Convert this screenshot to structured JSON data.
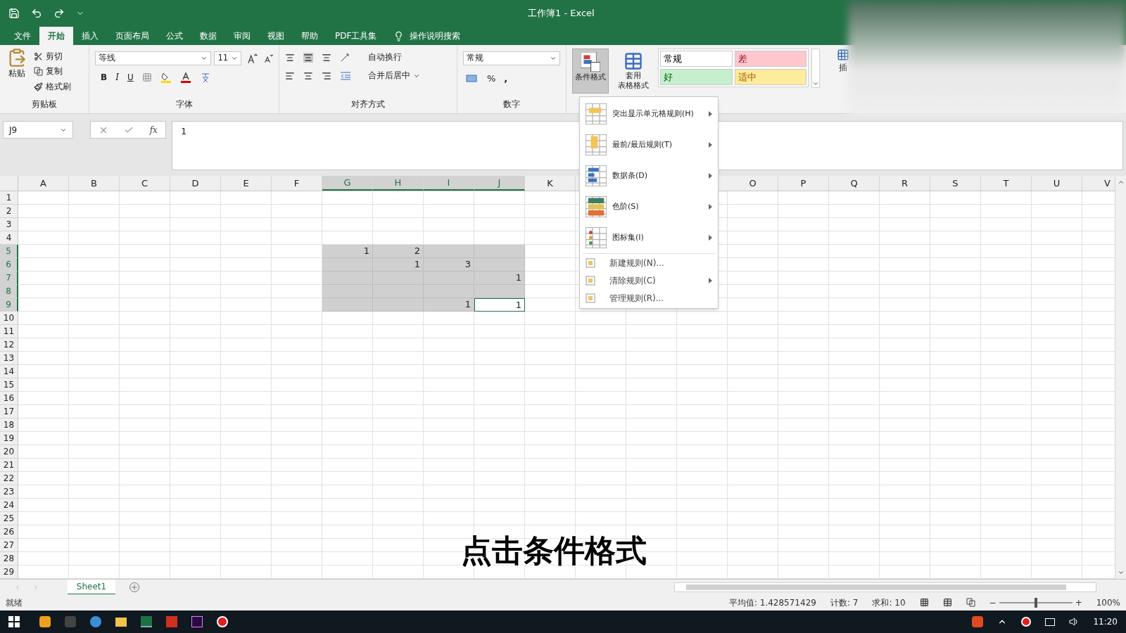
{
  "title_bar": {
    "title": "工作簿1 - Excel"
  },
  "ribbon_tabs": [
    {
      "label": "文件",
      "selected": false
    },
    {
      "label": "开始",
      "selected": true
    },
    {
      "label": "插入",
      "selected": false
    },
    {
      "label": "页面布局",
      "selected": false
    },
    {
      "label": "公式",
      "selected": false
    },
    {
      "label": "数据",
      "selected": false
    },
    {
      "label": "审阅",
      "selected": false
    },
    {
      "label": "视图",
      "selected": false
    },
    {
      "label": "帮助",
      "selected": false
    },
    {
      "label": "PDF工具集",
      "selected": false
    }
  ],
  "tell_me": {
    "label": "操作说明搜索"
  },
  "ribbon": {
    "clipboard": {
      "paste": "粘贴",
      "cut": "剪切",
      "copy": "复制",
      "format_painter": "格式刷",
      "group": "剪贴板"
    },
    "font": {
      "name": "等线",
      "size": "11",
      "bold": "B",
      "italic": "I",
      "underline": "U",
      "group": "字体"
    },
    "alignment": {
      "wrap": "自动换行",
      "merge": "合并后居中",
      "group": "对齐方式"
    },
    "number": {
      "format": "常规",
      "percent": "%",
      "comma": ",",
      "group": "数字"
    },
    "conditional_formatting": {
      "label": "条件格式",
      "pressed": true
    },
    "format_as_table": {
      "label_1": "套用",
      "label_2": "表格格式"
    },
    "cell_styles": [
      {
        "label": "常规",
        "color": "#ffffff"
      },
      {
        "label": "差",
        "color": "#ffc7ce"
      },
      {
        "label": "好",
        "color": "#c6efce"
      },
      {
        "label": "适中",
        "color": "#ffeb9c"
      }
    ],
    "insert": {
      "label": "插"
    }
  },
  "formula_bar": {
    "name_box": "J9",
    "fx": "fx",
    "value": "1"
  },
  "sheet": {
    "columns": [
      {
        "label": "A",
        "selected": false
      },
      {
        "label": "B",
        "selected": false
      },
      {
        "label": "C",
        "selected": false
      },
      {
        "label": "D",
        "selected": false
      },
      {
        "label": "E",
        "selected": false
      },
      {
        "label": "F",
        "selected": false
      },
      {
        "label": "G",
        "selected": true
      },
      {
        "label": "H",
        "selected": true
      },
      {
        "label": "I",
        "selected": true
      },
      {
        "label": "J",
        "selected": true
      },
      {
        "label": "K",
        "selected": false
      },
      {
        "kind": "covered"
      },
      {
        "kind": "covered"
      },
      {
        "kind": "covered"
      },
      {
        "label": "O",
        "selected": false
      },
      {
        "label": "P",
        "selected": false
      },
      {
        "label": "Q",
        "selected": false
      },
      {
        "label": "R",
        "selected": false
      },
      {
        "label": "S",
        "selected": false
      },
      {
        "label": "T",
        "selected": false
      },
      {
        "label": "U",
        "selected": false
      },
      {
        "label": "V",
        "selected": false
      }
    ],
    "rows": [
      {
        "label": "1",
        "selected": false
      },
      {
        "label": "2",
        "selected": false
      },
      {
        "label": "3",
        "selected": false
      },
      {
        "label": "4",
        "selected": false
      },
      {
        "label": "5",
        "selected": true,
        "cells": [
          {
            "kind": "value",
            "value": "1"
          },
          {
            "kind": "value",
            "value": "2"
          },
          {
            "kind": "blank"
          },
          {
            "kind": "blank"
          }
        ]
      },
      {
        "label": "6",
        "selected": true,
        "cells": [
          {
            "kind": "blank"
          },
          {
            "kind": "value",
            "value": "1"
          },
          {
            "kind": "value",
            "value": "3"
          },
          {
            "kind": "blank"
          }
        ]
      },
      {
        "label": "7",
        "selected": true,
        "cells": [
          {
            "kind": "blank"
          },
          {
            "kind": "blank"
          },
          {
            "kind": "blank"
          },
          {
            "kind": "value",
            "value": "1"
          }
        ]
      },
      {
        "label": "8",
        "selected": true,
        "cells": [
          {
            "kind": "blank"
          },
          {
            "kind": "blank"
          },
          {
            "kind": "blank"
          },
          {
            "kind": "blank"
          }
        ]
      },
      {
        "label": "9",
        "selected": true,
        "cells": [
          {
            "kind": "blank"
          },
          {
            "kind": "blank"
          },
          {
            "kind": "value",
            "value": "1"
          },
          {
            "kind": "active",
            "value": "1"
          }
        ]
      },
      {
        "label": "10",
        "selected": false
      },
      {
        "label": "11",
        "selected": false
      },
      {
        "label": "12",
        "selected": false
      },
      {
        "label": "13",
        "selected": false
      },
      {
        "label": "14",
        "selected": false
      },
      {
        "label": "15",
        "selected": false
      },
      {
        "label": "16",
        "selected": false
      },
      {
        "label": "17",
        "selected": false
      },
      {
        "label": "18",
        "selected": false
      },
      {
        "label": "19",
        "selected": false
      },
      {
        "label": "20",
        "selected": false
      },
      {
        "label": "21",
        "selected": false
      },
      {
        "label": "22",
        "selected": false
      },
      {
        "label": "23",
        "selected": false
      },
      {
        "label": "24",
        "selected": false
      },
      {
        "label": "25",
        "selected": false
      },
      {
        "label": "26",
        "selected": false
      },
      {
        "label": "27",
        "selected": false
      },
      {
        "label": "28",
        "selected": false
      },
      {
        "label": "29",
        "selected": false
      }
    ]
  },
  "cf_menu": {
    "items": [
      {
        "kind": "large",
        "label": "突出显示单元格规则(H)",
        "submenu": true
      },
      {
        "kind": "large",
        "label": "最前/最后规则(T)",
        "submenu": true
      },
      {
        "kind": "large",
        "label": "数据条(D)",
        "submenu": true
      },
      {
        "kind": "large",
        "label": "色阶(S)",
        "submenu": true
      },
      {
        "kind": "large",
        "label": "图标集(I)",
        "submenu": true
      },
      {
        "kind": "small",
        "label": "新建规则(N)...",
        "submenu": false
      },
      {
        "kind": "small",
        "label": "清除规则(C)",
        "submenu": true
      },
      {
        "kind": "small",
        "label": "管理规则(R)...",
        "submenu": false
      }
    ]
  },
  "sheet_tabs": [
    {
      "label": "Sheet1",
      "selected": true
    }
  ],
  "status_bar": {
    "ready": "就绪",
    "average": "平均值: 1.428571429",
    "count": "计数: 7",
    "sum": "求和: 10",
    "zoom_out": "−",
    "zoom_in": "+",
    "zoom": "100%",
    "level": 0.5
  },
  "taskbar": {
    "time": "11:20"
  },
  "caption": "点击条件格式"
}
